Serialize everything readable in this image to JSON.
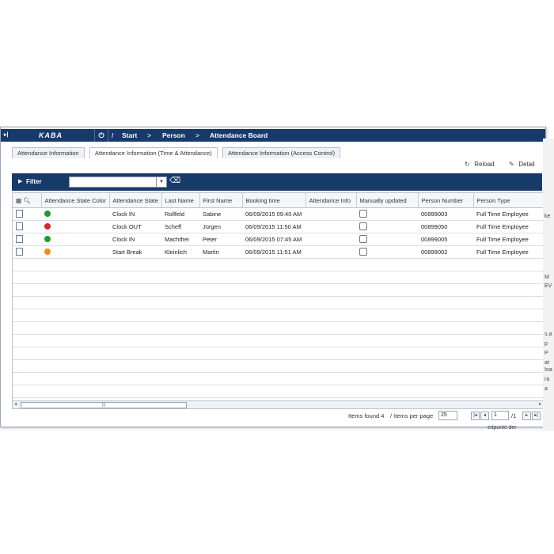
{
  "breadcrumb": {
    "logo": "KABA",
    "items": [
      "Start",
      "Person",
      "Attendance Board"
    ],
    "separator": ">"
  },
  "tabs": [
    {
      "label": "Attendance Information",
      "active": false
    },
    {
      "label": "Attendance Information (Time & Attendance)",
      "active": true
    },
    {
      "label": "Attendance Information (Access Control)",
      "active": false
    }
  ],
  "toolbar": {
    "reload_label": "Reload",
    "detail_label": "Detail"
  },
  "filter": {
    "label": "Filter",
    "value": ""
  },
  "grid": {
    "columns": [
      "Attendance State Color",
      "Attendance State",
      "Last Name",
      "First Name",
      "Booking time",
      "Attendance Info",
      "Manually updated",
      "Person Number",
      "Person Type"
    ],
    "rows": [
      {
        "color": "#1e9c2e",
        "state": "Clock IN",
        "last": "Rollfeld",
        "first": "Sabine",
        "time": "06/09/2015 09:40 AM",
        "info": "",
        "manual": false,
        "number": "00899003",
        "type": "Full Time Employee"
      },
      {
        "color": "#e02424",
        "state": "Clock OUT",
        "last": "Scheff",
        "first": "Jürgen",
        "time": "06/09/2015 11:50 AM",
        "info": "",
        "manual": false,
        "number": "00899050",
        "type": "Full Time Employee"
      },
      {
        "color": "#1e9c2e",
        "state": "Clock IN",
        "last": "Machtfrei",
        "first": "Peter",
        "time": "06/09/2015 07:45 AM",
        "info": "",
        "manual": false,
        "number": "00899005",
        "type": "Full Time Employee"
      },
      {
        "color": "#f08c1a",
        "state": "Start Break",
        "last": "Kleinlich",
        "first": "Martin",
        "time": "06/09/2015 11:51 AM",
        "info": "",
        "manual": false,
        "number": "00899002",
        "type": "Full Time Employee"
      }
    ]
  },
  "pager": {
    "items_found_label": "Items found 4",
    "per_page_label": "/ Items per page",
    "per_page_value": "25",
    "page_value": "1",
    "page_total": "/1"
  },
  "right_edge_fragments": [
    "ke",
    "M",
    "EV",
    "s.a",
    "p",
    "P",
    "at",
    "Ina",
    "ra",
    "a",
    "eitpunkt der"
  ]
}
